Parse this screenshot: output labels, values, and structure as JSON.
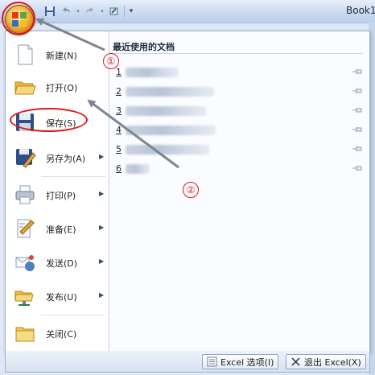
{
  "window": {
    "title": "Book1"
  },
  "quick_access": [
    {
      "icon": "save-icon"
    },
    {
      "icon": "undo-icon"
    },
    {
      "icon": "redo-icon"
    },
    {
      "icon": "customize-dropdown-icon"
    }
  ],
  "menu": {
    "items": [
      {
        "label": "新建(N)",
        "icon": "new-document-icon",
        "has_submenu": false
      },
      {
        "label": "打开(O)",
        "icon": "open-folder-icon",
        "has_submenu": false
      },
      {
        "label": "保存(S)",
        "icon": "save-disk-icon",
        "has_submenu": false
      },
      {
        "label": "另存为(A)",
        "icon": "save-as-icon",
        "has_submenu": true
      },
      {
        "label": "打印(P)",
        "icon": "printer-icon",
        "has_submenu": true
      },
      {
        "label": "准备(E)",
        "icon": "prepare-icon",
        "has_submenu": true
      },
      {
        "label": "发送(D)",
        "icon": "send-icon",
        "has_submenu": true
      },
      {
        "label": "发布(U)",
        "icon": "publish-icon",
        "has_submenu": true
      },
      {
        "label": "关闭(C)",
        "icon": "close-folder-icon",
        "has_submenu": false
      }
    ]
  },
  "recent": {
    "title": "最近使用的文档",
    "items": [
      {
        "number": "1"
      },
      {
        "number": "2"
      },
      {
        "number": "3"
      },
      {
        "number": "4"
      },
      {
        "number": "5"
      },
      {
        "number": "6"
      }
    ]
  },
  "bottom_buttons": {
    "options_label": "Excel 选项(I)",
    "exit_label": "退出 Excel(X)"
  },
  "annotations": {
    "marker_1": "①",
    "marker_2": "②",
    "color": "#e0161a"
  }
}
